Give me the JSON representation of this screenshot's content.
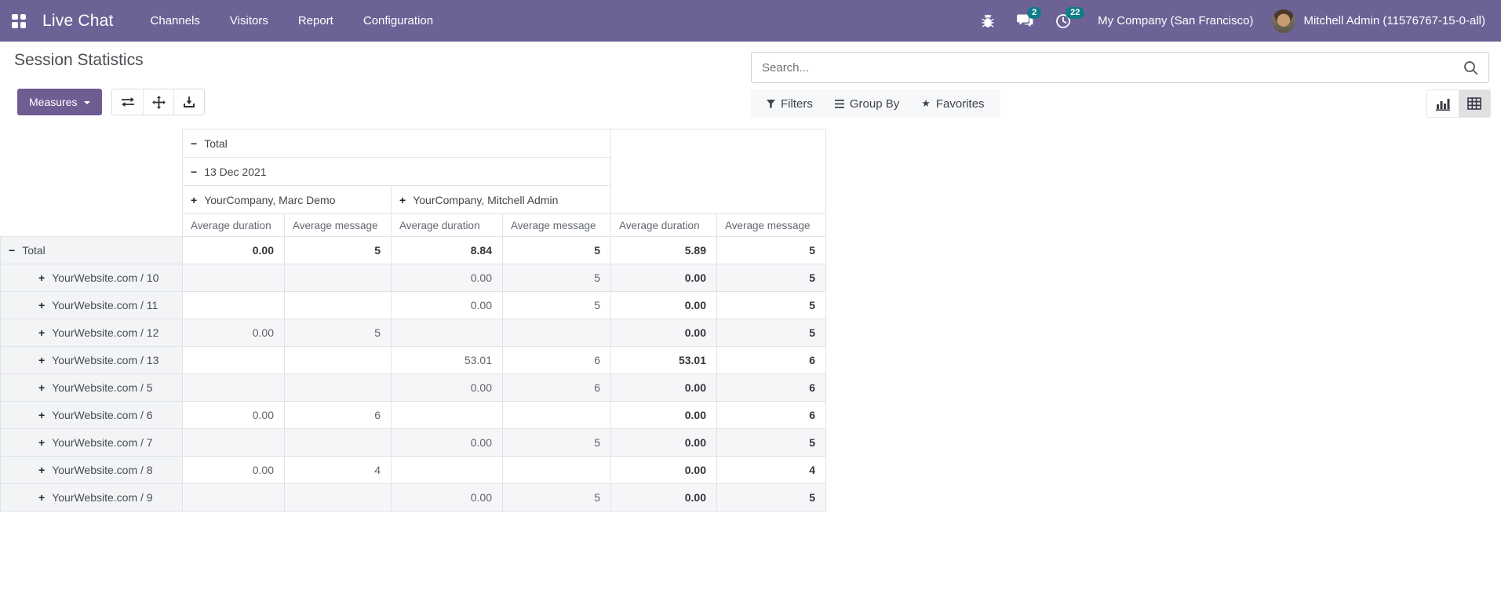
{
  "navbar": {
    "app_name": "Live Chat",
    "menus": [
      "Channels",
      "Visitors",
      "Report",
      "Configuration"
    ],
    "messages_badge": "2",
    "activities_badge": "22",
    "company": "My Company (San Francisco)",
    "user": "Mitchell Admin (11576767-15-0-all)"
  },
  "control_panel": {
    "title": "Session Statistics",
    "measures_label": "Measures",
    "search_placeholder": "Search...",
    "filters_label": "Filters",
    "group_by_label": "Group By",
    "favorites_label": "Favorites"
  },
  "icons": {
    "apps": "grid-2x2-squares",
    "bug": "bug",
    "messages": "speech-bubbles",
    "activities": "clock",
    "search": "magnifier",
    "filter": "funnel",
    "group_by": "horizontal-bars",
    "favorites": "★",
    "measures_caret": "▾",
    "flip_axis": "⇄",
    "expand_all": "four-direction-arrows",
    "download": "arrow-into-tray",
    "bar_chart_view": "bar-chart",
    "pivot_view": "table-grid"
  },
  "colors": {
    "navbar_bg": "#6d6295",
    "primary_button": "#6f5c92",
    "badge": "#0e7d87",
    "table_border": "#e0e3e7",
    "row_stripe": "#f6f6f8",
    "row_header_bg": "#f3f4f6",
    "active_view_bg": "#dfe0e2"
  },
  "pivot": {
    "collapse_icon": "−",
    "expand_icon": "+",
    "col_headers": {
      "total": "Total",
      "date": "13 Dec 2021",
      "groups": [
        "YourCompany, Marc Demo",
        "YourCompany, Mitchell Admin"
      ],
      "measures": [
        "Average duration",
        "Average message",
        "Average duration",
        "Average message",
        "Average duration",
        "Average message"
      ]
    },
    "rows": [
      {
        "label": "Total",
        "icon": "−",
        "cells": [
          "0.00",
          "5",
          "8.84",
          "5",
          "5.89",
          "5"
        ]
      },
      {
        "label": "YourWebsite.com / 10",
        "icon": "+",
        "cells": [
          "",
          "",
          "0.00",
          "5",
          "0.00",
          "5"
        ]
      },
      {
        "label": "YourWebsite.com / 11",
        "icon": "+",
        "cells": [
          "",
          "",
          "0.00",
          "5",
          "0.00",
          "5"
        ]
      },
      {
        "label": "YourWebsite.com / 12",
        "icon": "+",
        "cells": [
          "0.00",
          "5",
          "",
          "",
          "0.00",
          "5"
        ]
      },
      {
        "label": "YourWebsite.com / 13",
        "icon": "+",
        "cells": [
          "",
          "",
          "53.01",
          "6",
          "53.01",
          "6"
        ]
      },
      {
        "label": "YourWebsite.com / 5",
        "icon": "+",
        "cells": [
          "",
          "",
          "0.00",
          "6",
          "0.00",
          "6"
        ]
      },
      {
        "label": "YourWebsite.com / 6",
        "icon": "+",
        "cells": [
          "0.00",
          "6",
          "",
          "",
          "0.00",
          "6"
        ]
      },
      {
        "label": "YourWebsite.com / 7",
        "icon": "+",
        "cells": [
          "",
          "",
          "0.00",
          "5",
          "0.00",
          "5"
        ]
      },
      {
        "label": "YourWebsite.com / 8",
        "icon": "+",
        "cells": [
          "0.00",
          "4",
          "",
          "",
          "0.00",
          "4"
        ]
      },
      {
        "label": "YourWebsite.com / 9",
        "icon": "+",
        "cells": [
          "",
          "",
          "0.00",
          "5",
          "0.00",
          "5"
        ]
      }
    ]
  }
}
